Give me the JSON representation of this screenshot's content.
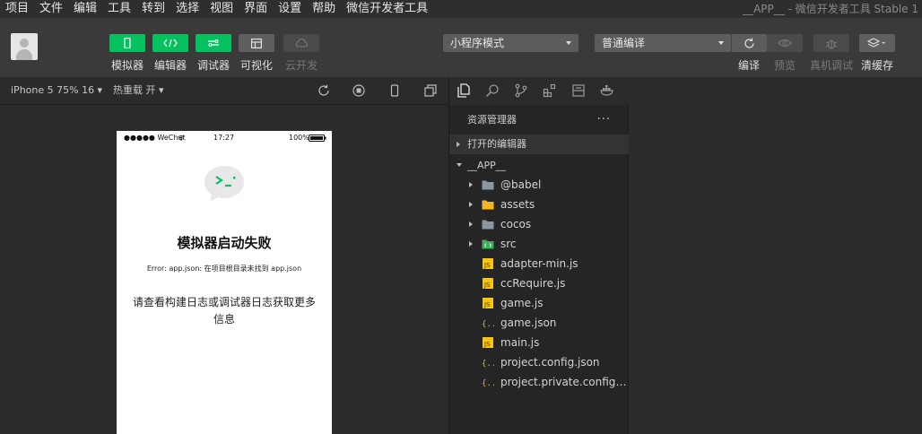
{
  "menu": {
    "items": [
      "项目",
      "文件",
      "编辑",
      "工具",
      "转到",
      "选择",
      "视图",
      "界面",
      "设置",
      "帮助",
      "微信开发者工具"
    ],
    "window_title": "__APP__ - 微信开发者工具 Stable 1"
  },
  "toolbar": {
    "simulator": "模拟器",
    "editor": "编辑器",
    "debugger": "调试器",
    "visualize": "可视化",
    "cloud": "云开发",
    "mode_select": "小程序模式",
    "compile_select": "普通编译",
    "compile": "编译",
    "preview": "预览",
    "remote_debug": "真机调试",
    "clear_cache": "清缓存"
  },
  "subbar": {
    "device": "iPhone 5 75% 16 ▾",
    "hot_reload": "热重载 开 ▾"
  },
  "simulator": {
    "carrier": "●●●●● WeChat",
    "time": "17:27",
    "battery": "100%",
    "title": "模拟器启动失败",
    "error": "Error: app.json: 在项目根目录未找到 app.json",
    "message": "请查看构建日志或调试器日志获取更多信息"
  },
  "explorer": {
    "title": "资源管理器",
    "more": "···",
    "open_editors": "打开的编辑器",
    "project": "__APP__",
    "files": [
      {
        "name": "@babel",
        "kind": "folder"
      },
      {
        "name": "assets",
        "kind": "folder-yellow"
      },
      {
        "name": "cocos",
        "kind": "folder"
      },
      {
        "name": "src",
        "kind": "folder-green"
      },
      {
        "name": "adapter-min.js",
        "kind": "js"
      },
      {
        "name": "ccRequire.js",
        "kind": "js"
      },
      {
        "name": "game.js",
        "kind": "js"
      },
      {
        "name": "game.json",
        "kind": "json"
      },
      {
        "name": "main.js",
        "kind": "js"
      },
      {
        "name": "project.config.json",
        "kind": "json"
      },
      {
        "name": "project.private.config.json",
        "kind": "json"
      }
    ]
  },
  "colors": {
    "accent_green": "#07c160",
    "js_icon": "#f5c518",
    "json_icon": "#e6b422",
    "folder_gray": "#8c96a0"
  }
}
